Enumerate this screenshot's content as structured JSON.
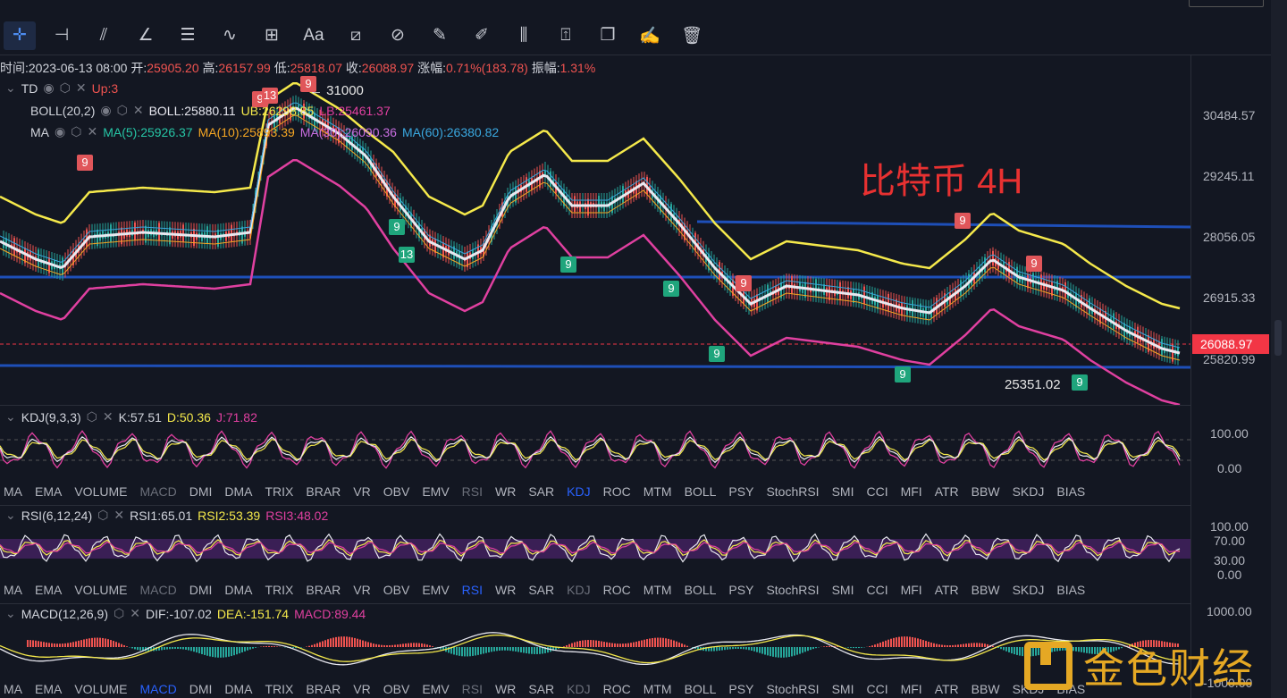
{
  "toolbar": {
    "tools": [
      {
        "name": "crosshair-icon",
        "glyph": "✛",
        "active": true
      },
      {
        "name": "horizontal-line-icon",
        "glyph": "⊣"
      },
      {
        "name": "trend-lines-icon",
        "glyph": "⫽"
      },
      {
        "name": "angle-icon",
        "glyph": "∠"
      },
      {
        "name": "parallel-channel-icon",
        "glyph": "☰"
      },
      {
        "name": "wave-icon",
        "glyph": "∿"
      },
      {
        "name": "rectangle-icon",
        "glyph": "⊞"
      },
      {
        "name": "text-icon",
        "glyph": "Aa"
      },
      {
        "name": "ruler-icon",
        "glyph": "⧄"
      },
      {
        "name": "magnet-icon",
        "glyph": "⊘"
      },
      {
        "name": "marker-icon",
        "glyph": "✎"
      },
      {
        "name": "pencil-icon",
        "glyph": "✐"
      },
      {
        "name": "candles-icon",
        "glyph": "⫼"
      },
      {
        "name": "lock-icon",
        "glyph": "⍐"
      },
      {
        "name": "copy-icon",
        "glyph": "❐"
      },
      {
        "name": "edit-icon",
        "glyph": "✍"
      },
      {
        "name": "trash-icon",
        "glyph": "🗑"
      }
    ]
  },
  "ohlc": {
    "time_label": "时间:",
    "time": "2023-06-13 08:00",
    "open_label": "开:",
    "open": "25905.20",
    "high_label": "高:",
    "high": "26157.99",
    "low_label": "低:",
    "low": "25818.07",
    "close_label": "收:",
    "close": "26088.97",
    "change_label": "涨幅:",
    "change": "0.71%(183.78)",
    "amp_label": "振幅:",
    "amp": "1.31%"
  },
  "indicators": {
    "td": {
      "name": "TD",
      "value": "Up:3"
    },
    "boll": {
      "name": "BOLL(20,2)",
      "boll": "BOLL:25880.11",
      "ub": "UB:26298.85",
      "lb": "LB:25461.37"
    },
    "ma": {
      "name": "MA",
      "ma5": "MA(5):25926.37",
      "ma10": "MA(10):25893.39",
      "ma30": "MA(30):26090.36",
      "ma60": "MA(60):26380.82"
    }
  },
  "price_axis": [
    "30484.57",
    "29245.11",
    "28056.05",
    "26915.33",
    "25820.99"
  ],
  "current_price": "26088.97",
  "title": "比特币 4H",
  "peak_label": "← 31000",
  "low_label": "25351.02",
  "td_marks": [
    {
      "t": "9",
      "k": "s"
    },
    {
      "t": "9",
      "k": "s"
    },
    {
      "t": "13",
      "k": "s"
    },
    {
      "t": "9",
      "k": "s"
    },
    {
      "t": "9",
      "k": "b"
    },
    {
      "t": "13",
      "k": "b"
    },
    {
      "t": "9",
      "k": "b"
    },
    {
      "t": "9",
      "k": "b"
    },
    {
      "t": "9",
      "k": "s"
    },
    {
      "t": "9",
      "k": "b"
    },
    {
      "t": "9",
      "k": "s"
    },
    {
      "t": "9",
      "k": "s"
    },
    {
      "t": "9",
      "k": "b"
    },
    {
      "t": "9",
      "k": "b"
    }
  ],
  "kdj": {
    "name": "KDJ(9,3,3)",
    "k": "K:57.51",
    "d": "D:50.36",
    "j": "J:71.82",
    "axis": [
      "100.00",
      "0.00"
    ]
  },
  "rsi": {
    "name": "RSI(6,12,24)",
    "r1": "RSI1:65.01",
    "r2": "RSI2:53.39",
    "r3": "RSI3:48.02",
    "axis": [
      "100.00",
      "70.00",
      "30.00",
      "0.00"
    ]
  },
  "macd": {
    "name": "MACD(12,26,9)",
    "dif": "DIF:-107.02",
    "dea": "DEA:-151.74",
    "macd": "MACD:89.44",
    "axis": [
      "1000.00",
      "-1000.00"
    ]
  },
  "tab_list": [
    "MA",
    "EMA",
    "VOLUME",
    "MACD",
    "DMI",
    "DMA",
    "TRIX",
    "BRAR",
    "VR",
    "OBV",
    "EMV",
    "RSI",
    "WR",
    "SAR",
    "KDJ",
    "ROC",
    "MTM",
    "BOLL",
    "PSY",
    "StochRSI",
    "SMI",
    "CCI",
    "MFI",
    "ATR",
    "BBW",
    "SKDJ",
    "BIAS"
  ],
  "tabs_kdj": {
    "active": "KDJ",
    "dim": [
      "MACD",
      "RSI"
    ]
  },
  "tabs_rsi": {
    "active": "RSI",
    "dim": [
      "MACD",
      "KDJ"
    ]
  },
  "tabs_macd": {
    "active": "MACD",
    "dim": [
      "RSI",
      "KDJ"
    ]
  },
  "watermark": "金色财经",
  "colors": {
    "bg": "#131722",
    "up": "#26a69a",
    "down": "#ef5350",
    "boll_upper": "#f5e94b",
    "boll_mid": "#e8e8f0",
    "boll_lower": "#e040a0",
    "channel": "#1e4fb8"
  }
}
